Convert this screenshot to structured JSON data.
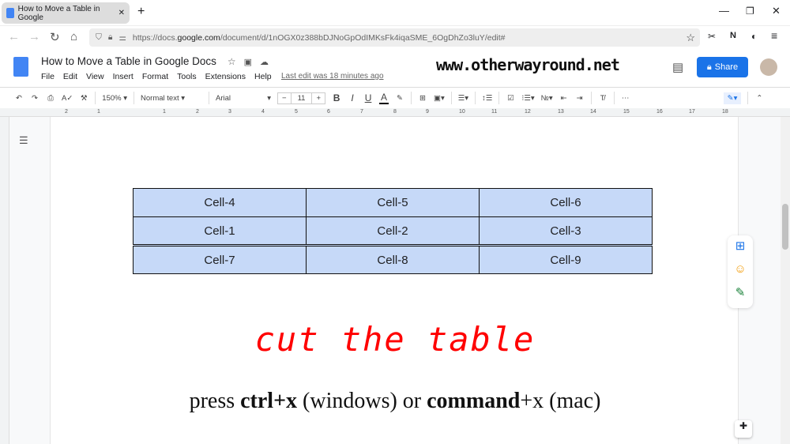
{
  "browser": {
    "tab_title": "How to Move a Table in Google",
    "url_prefix": "https://docs.",
    "url_domain": "google.com",
    "url_rest": "/document/d/1nOGX0z388bDJNoGpOdIMKsFk4iqaSME_6OgDhZo3luY/edit#"
  },
  "doc": {
    "title": "How to Move a Table in Google Docs",
    "menu": [
      "File",
      "Edit",
      "View",
      "Insert",
      "Format",
      "Tools",
      "Extensions",
      "Help"
    ],
    "last_edit": "Last edit was 18 minutes ago",
    "share": "Share"
  },
  "watermark": "www.otherwayround.net",
  "toolbar": {
    "zoom": "150%",
    "style": "Normal text",
    "font": "Arial",
    "font_size": "11"
  },
  "ruler": [
    "2",
    "1",
    "1",
    "2",
    "3",
    "4",
    "5",
    "6",
    "7",
    "8",
    "9",
    "10",
    "11",
    "12",
    "13",
    "14",
    "15",
    "16",
    "17",
    "18"
  ],
  "table": {
    "rows": [
      [
        "Cell-4",
        "Cell-5",
        "Cell-6"
      ],
      [
        "Cell-1",
        "Cell-2",
        "Cell-3"
      ],
      [
        "Cell-7",
        "Cell-8",
        "Cell-9"
      ]
    ],
    "fill": "#c6d9f8"
  },
  "annotation": {
    "handwritten": "cut the table",
    "p1": "press ",
    "k1": "ctrl+x",
    "p2": " (windows) or ",
    "k2": "command",
    "p3": "+x (mac)"
  },
  "colors": {
    "accent": "#1a73e8",
    "annotation": "#ff0000"
  }
}
